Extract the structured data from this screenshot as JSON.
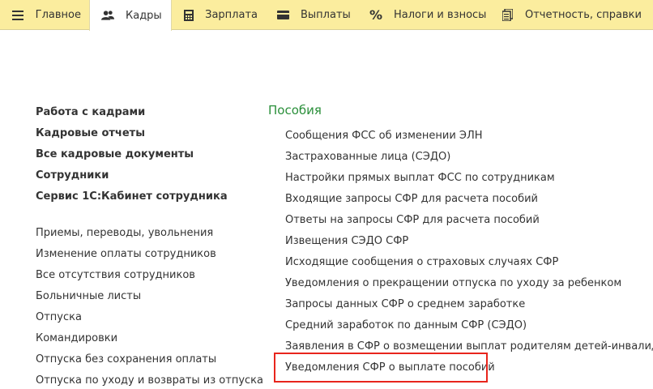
{
  "tabs": [
    {
      "label": "Главное",
      "icon": "menu-icon"
    },
    {
      "label": "Кадры",
      "icon": "people-icon",
      "active": true
    },
    {
      "label": "Зарплата",
      "icon": "calculator-icon"
    },
    {
      "label": "Выплаты",
      "icon": "wallet-icon"
    },
    {
      "label": "Налоги и взносы",
      "icon": "percent-icon"
    },
    {
      "label": "Отчетность, справки",
      "icon": "documents-icon"
    }
  ],
  "left_menu": {
    "primary": [
      "Работа с кадрами",
      "Кадровые отчеты",
      "Все кадровые документы",
      "Сотрудники",
      "Сервис 1С:Кабинет сотрудника"
    ],
    "secondary": [
      "Приемы, переводы, увольнения",
      "Изменение оплаты сотрудников",
      "Все отсутствия сотрудников",
      "Больничные листы",
      "Отпуска",
      "Командировки",
      "Отпуска без сохранения оплаты",
      "Отпуска по уходу и возвраты из отпуска"
    ]
  },
  "benefits": {
    "title": "Пособия",
    "items": [
      "Сообщения ФСС об изменении ЭЛН",
      "Застрахованные лица (СЭДО)",
      "Настройки прямых выплат ФСС по сотрудникам",
      "Входящие запросы СФР для расчета пособий",
      "Ответы на запросы СФР для расчета пособий",
      "Извещения СЭДО СФР",
      "Исходящие сообщения о страховых случаях СФР",
      "Уведомления о прекращении отпуска по уходу за ребенком",
      "Запросы данных СФР о среднем заработке",
      "Средний заработок по данным СФР (СЭДО)",
      "Заявления в СФР о возмещении выплат родителям детей-инвалидов",
      "Уведомления СФР о выплате пособий"
    ],
    "highlighted_index": 11,
    "highlight_color": "#e8251c",
    "title_color": "#2a8f3a"
  },
  "colors": {
    "tabbar_bg": "#fbed9e",
    "active_tab_bg": "#ffffff"
  }
}
